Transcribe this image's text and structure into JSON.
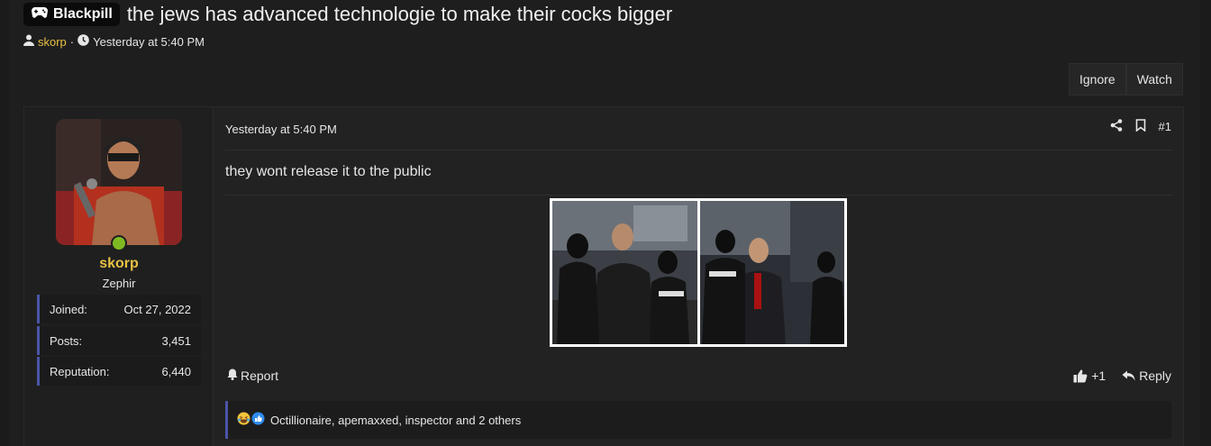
{
  "thread": {
    "prefix": "Blackpill",
    "title": "the jews has advanced technologie to make their cocks bigger",
    "author": "skorp",
    "separator": "·",
    "time": "Yesterday at 5:40 PM"
  },
  "buttons": {
    "ignore": "Ignore",
    "watch": "Watch"
  },
  "user": {
    "name": "skorp",
    "title": "Zephir",
    "stats": [
      {
        "label": "Joined:",
        "value": "Oct 27, 2022"
      },
      {
        "label": "Posts:",
        "value": "3,451"
      },
      {
        "label": "Reputation:",
        "value": "6,440"
      }
    ]
  },
  "post": {
    "date": "Yesterday at 5:40 PM",
    "number": "#1",
    "message": "they wont release it to the public",
    "report": "Report",
    "like_count": "+1",
    "reply": "Reply",
    "reactions_text": "Octillionaire, apemaxxed, inspector and 2 others"
  },
  "colors": {
    "accent_user": "#e7c144",
    "online": "#7fba23",
    "stat_border": "#4a55a8"
  }
}
